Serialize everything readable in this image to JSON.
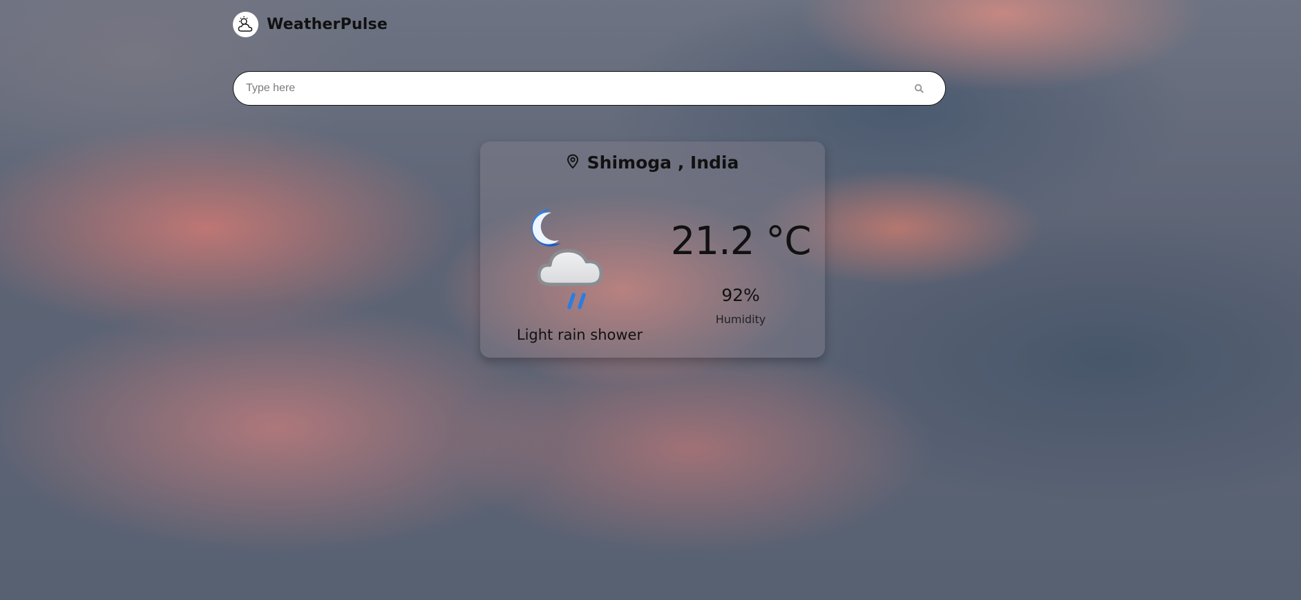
{
  "app": {
    "name": "WeatherPulse",
    "logo_icon": "weather-logo-icon"
  },
  "search": {
    "placeholder": "Type here",
    "value": "",
    "icon": "search-icon"
  },
  "weather": {
    "location_icon": "location-pin-icon",
    "location": "Shimoga , India",
    "condition_icon": "night-light-rain-icon",
    "condition": "Light rain shower",
    "temperature": "21.2 °C",
    "humidity_value": "92%",
    "humidity_label": "Humidity"
  },
  "colors": {
    "rain_blue": "#2a7de1",
    "moon_blue": "#1e6fd9",
    "cloud_gray": "#e8e8ea",
    "text_dark": "#111111"
  }
}
